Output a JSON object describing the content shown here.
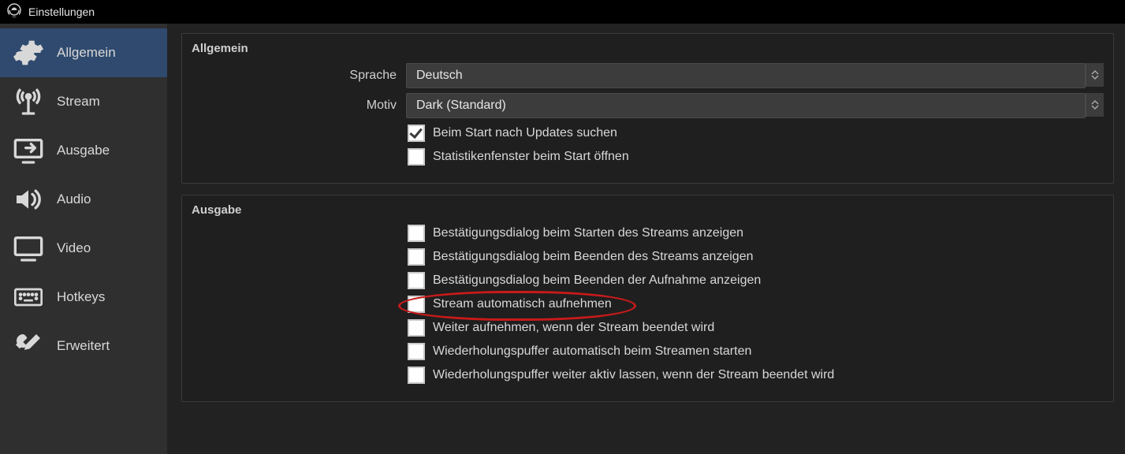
{
  "window": {
    "title": "Einstellungen"
  },
  "sidebar": {
    "items": [
      {
        "label": "Allgemein"
      },
      {
        "label": "Stream"
      },
      {
        "label": "Ausgabe"
      },
      {
        "label": "Audio"
      },
      {
        "label": "Video"
      },
      {
        "label": "Hotkeys"
      },
      {
        "label": "Erweitert"
      }
    ]
  },
  "panels": {
    "general": {
      "title": "Allgemein",
      "language_label": "Sprache",
      "language_value": "Deutsch",
      "theme_label": "Motiv",
      "theme_value": "Dark (Standard)",
      "chk_updates": "Beim Start nach Updates suchen",
      "chk_stats": "Statistikenfenster beim Start öffnen"
    },
    "output": {
      "title": "Ausgabe",
      "chk1": "Bestätigungsdialog beim Starten des Streams anzeigen",
      "chk2": "Bestätigungsdialog beim Beenden des Streams anzeigen",
      "chk3": "Bestätigungsdialog beim Beenden der Aufnahme anzeigen",
      "chk4": "Stream automatisch aufnehmen",
      "chk5": "Weiter aufnehmen, wenn der Stream beendet wird",
      "chk6": "Wiederholungspuffer automatisch beim Streamen starten",
      "chk7": "Wiederholungspuffer weiter aktiv lassen, wenn der Stream beendet wird"
    }
  }
}
